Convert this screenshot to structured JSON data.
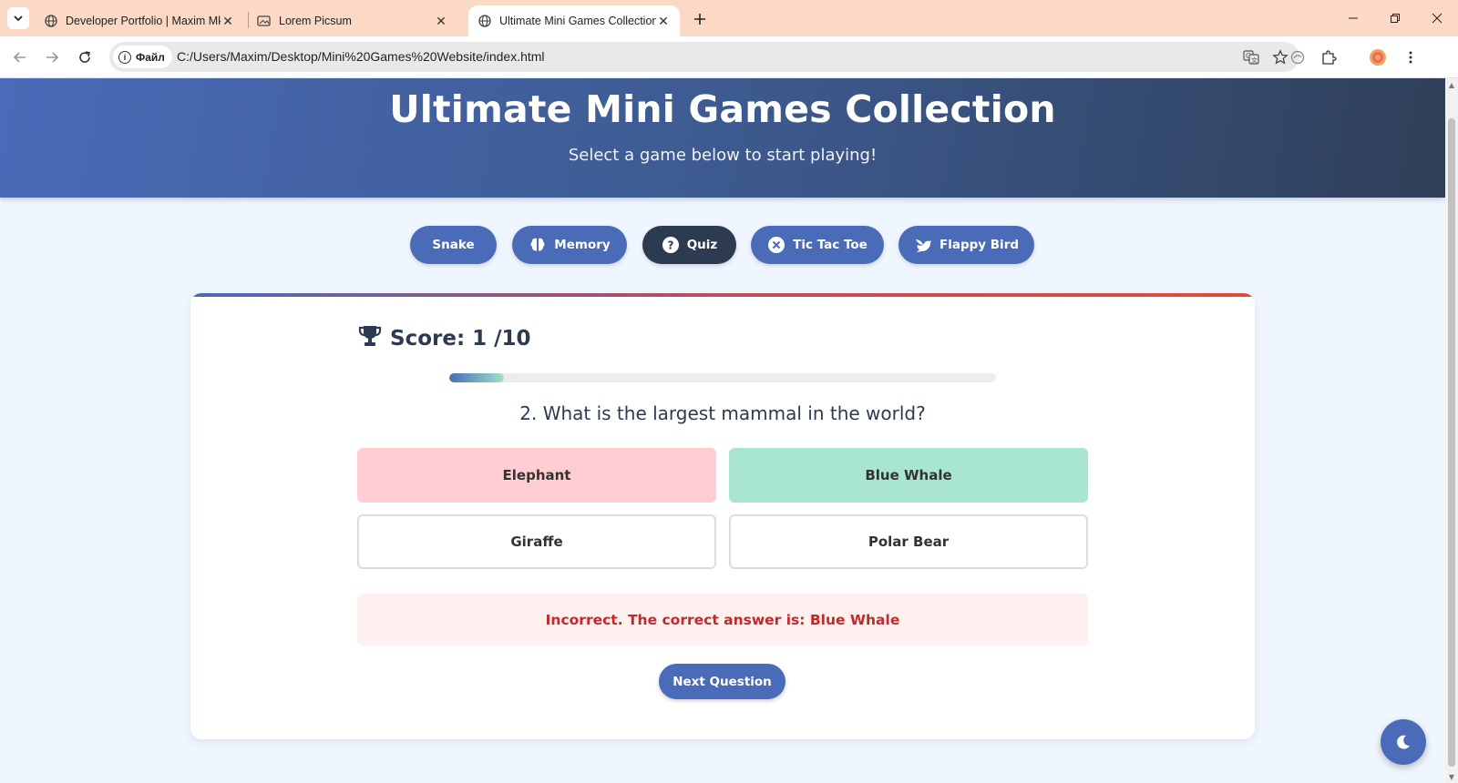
{
  "browser": {
    "tabs": [
      {
        "title": "Developer Portfolio | Maxim Mk",
        "icon": "globe-icon"
      },
      {
        "title": "Lorem Picsum",
        "icon": "image-icon"
      },
      {
        "title": "Ultimate Mini Games Collection",
        "icon": "globe-icon",
        "active": true
      }
    ],
    "site_chip": "Файл",
    "url": "C:/Users/Maxim/Desktop/Mini%20Games%20Website/index.html"
  },
  "page": {
    "title": "Ultimate Mini Games Collection",
    "subtitle": "Select a game below to start playing!",
    "games": [
      {
        "label": "Snake",
        "icon": ""
      },
      {
        "label": "Memory",
        "icon": "brain-icon"
      },
      {
        "label": "Quiz",
        "icon": "question-circle-icon",
        "active": true
      },
      {
        "label": "Tic Tac Toe",
        "icon": "x-circle-icon"
      },
      {
        "label": "Flappy Bird",
        "icon": "dove-icon"
      }
    ],
    "quiz": {
      "score_label": "Score: 1 /10",
      "progress": 0.1,
      "question": "2. What is the largest mammal in the world?",
      "answers": [
        {
          "label": "Elephant",
          "state": "wrong"
        },
        {
          "label": "Blue Whale",
          "state": "correct"
        },
        {
          "label": "Giraffe",
          "state": "neutral"
        },
        {
          "label": "Polar Bear",
          "state": "neutral"
        }
      ],
      "feedback": "Incorrect. The correct answer is: Blue Whale",
      "next_label": "Next Question"
    }
  },
  "colors": {
    "primary": "#4a6bb8",
    "dark": "#2d3b50",
    "wrong": "#ffcdd2",
    "correct": "#a8e6cf",
    "error_text": "#c62828"
  }
}
